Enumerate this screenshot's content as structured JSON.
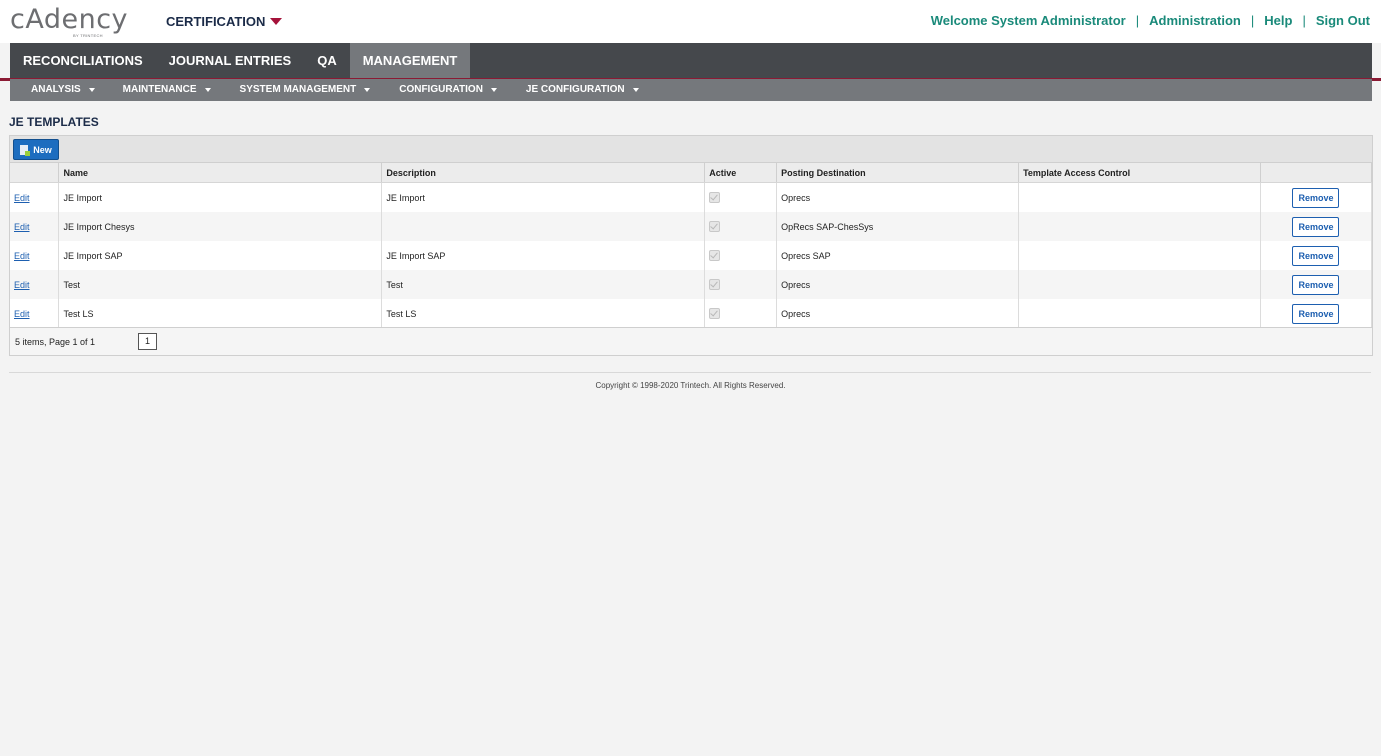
{
  "logo": {
    "word": "cAdency",
    "sub": "BY TRINTECH"
  },
  "environment": {
    "label": "CERTIFICATION"
  },
  "top_links": {
    "welcome": "Welcome System Administrator",
    "administration": "Administration",
    "help": "Help",
    "sign_out": "Sign Out",
    "separator": "|"
  },
  "main_nav": [
    {
      "label": "RECONCILIATIONS"
    },
    {
      "label": "JOURNAL ENTRIES"
    },
    {
      "label": "QA"
    },
    {
      "label": "MANAGEMENT",
      "active": true
    }
  ],
  "sub_nav": [
    {
      "label": "ANALYSIS"
    },
    {
      "label": "MAINTENANCE"
    },
    {
      "label": "SYSTEM MANAGEMENT"
    },
    {
      "label": "CONFIGURATION"
    },
    {
      "label": "JE CONFIGURATION"
    }
  ],
  "page": {
    "title": "JE TEMPLATES"
  },
  "toolbar": {
    "new_label": "New"
  },
  "table": {
    "columns": [
      "",
      "Name",
      "Description",
      "Active",
      "Posting Destination",
      "Template Access Control",
      ""
    ],
    "edit_label": "Edit",
    "remove_label": "Remove",
    "rows": [
      {
        "name": "JE Import",
        "description": "JE Import",
        "active": true,
        "posting_destination": "Oprecs",
        "access_control": ""
      },
      {
        "name": "JE Import Chesys",
        "description": "",
        "active": true,
        "posting_destination": "OpRecs SAP-ChesSys",
        "access_control": ""
      },
      {
        "name": "JE Import SAP",
        "description": "JE Import SAP",
        "active": true,
        "posting_destination": "Oprecs SAP",
        "access_control": ""
      },
      {
        "name": "Test",
        "description": "Test",
        "active": true,
        "posting_destination": "Oprecs",
        "access_control": ""
      },
      {
        "name": "Test LS",
        "description": "Test LS",
        "active": true,
        "posting_destination": "Oprecs",
        "access_control": ""
      }
    ]
  },
  "pager": {
    "info": "5 items, Page 1 of 1",
    "page": "1"
  },
  "footer": {
    "copyright": "Copyright © 1998-2020 Trintech. All Rights Reserved."
  },
  "colors": {
    "nav_dark": "#45484c",
    "nav_active": "#75787c",
    "accent_red": "#8b1a34",
    "link_teal": "#1a8a7a",
    "button_blue": "#1d6dbf"
  }
}
